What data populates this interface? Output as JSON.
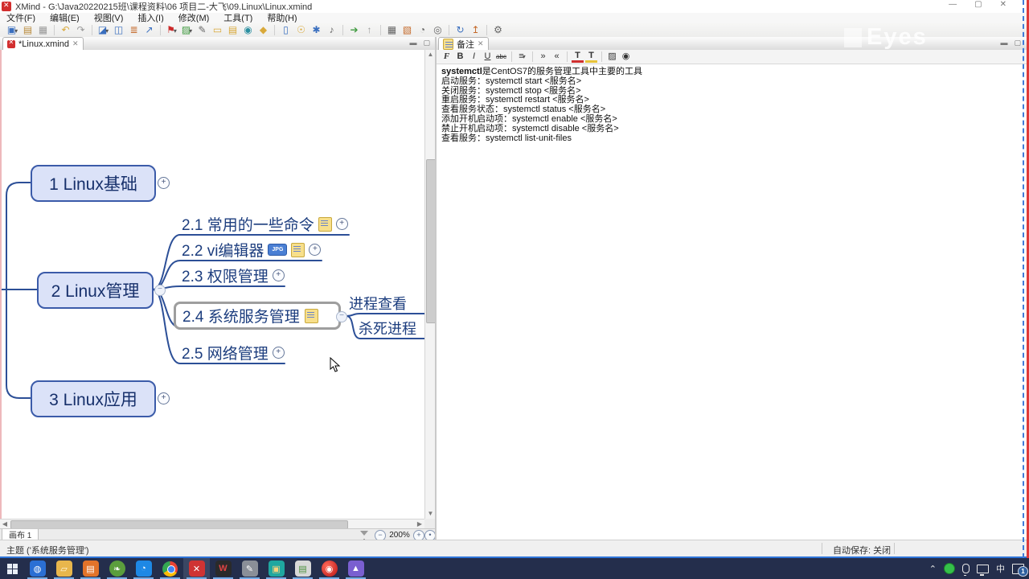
{
  "window": {
    "title": "XMind - G:\\Java20220215班\\课程资料\\06 项目二-大飞\\09.Linux\\Linux.xmind"
  },
  "menu": {
    "items": [
      "文件(F)",
      "编辑(E)",
      "视图(V)",
      "插入(I)",
      "修改(M)",
      "工具(T)",
      "帮助(H)"
    ]
  },
  "toolbar": {
    "icons": [
      {
        "name": "new-workbook",
        "glyph": "▣"
      },
      {
        "name": "open-file",
        "glyph": "▤"
      },
      {
        "name": "save",
        "glyph": "▦"
      },
      {
        "name": "undo",
        "glyph": "↶"
      },
      {
        "name": "redo",
        "glyph": "↷"
      },
      {
        "name": "theme",
        "glyph": "◪"
      },
      {
        "name": "map-structure",
        "glyph": "◫"
      },
      {
        "name": "outline-numbering",
        "glyph": "≣"
      },
      {
        "name": "relationship",
        "glyph": "↗"
      },
      {
        "name": "marker",
        "glyph": "⚑"
      },
      {
        "name": "insert-image",
        "glyph": "▨"
      },
      {
        "name": "attachment",
        "glyph": "✎"
      },
      {
        "name": "boundary",
        "glyph": "▭"
      },
      {
        "name": "insert-notes",
        "glyph": "▤"
      },
      {
        "name": "hyperlink",
        "glyph": "◉"
      },
      {
        "name": "label",
        "glyph": "◆"
      },
      {
        "name": "presentation",
        "glyph": "▯"
      },
      {
        "name": "brainstorm",
        "glyph": "☉"
      },
      {
        "name": "drill-down",
        "glyph": "✱"
      },
      {
        "name": "audio-note",
        "glyph": "♪"
      },
      {
        "name": "share",
        "glyph": "➔"
      },
      {
        "name": "upload",
        "glyph": "↑"
      },
      {
        "name": "table-view",
        "glyph": "▦"
      },
      {
        "name": "gantt-view",
        "glyph": "▧"
      },
      {
        "name": "timer",
        "glyph": "◔"
      },
      {
        "name": "zoom-tool",
        "glyph": "◎"
      },
      {
        "name": "cloud-sync",
        "glyph": "↻"
      },
      {
        "name": "export",
        "glyph": "↥"
      },
      {
        "name": "preferences",
        "glyph": "⚙"
      }
    ]
  },
  "editor": {
    "tab_label": "*Linux.xmind"
  },
  "mindmap": {
    "zoom_level": "200%",
    "colors": {
      "node_fill": "#dbe2f8",
      "node_border": "#3b5ba9",
      "branch": "#2c4f97",
      "text": "#1c3d7e",
      "selection": "#9e9e9e"
    },
    "level1": [
      {
        "label": "1 Linux基础"
      },
      {
        "label": "2 Linux管理"
      },
      {
        "label": "3 Linux应用"
      }
    ],
    "level2": [
      {
        "label": "2.1 常用的一些命令"
      },
      {
        "label": "2.2 vi编辑器"
      },
      {
        "label": "2.3 权限管理"
      },
      {
        "label": "2.4 系统服务管理"
      },
      {
        "label": "2.5 网络管理"
      }
    ],
    "level3": [
      {
        "label": "进程查看"
      },
      {
        "label": "杀死进程"
      }
    ],
    "jpg_badge": "JPG"
  },
  "canvas_bar": {
    "sheet": "画布 1",
    "zoom_level": "200%"
  },
  "notes": {
    "tab": "备注",
    "toolbar": [
      {
        "name": "font",
        "glyph": "F"
      },
      {
        "name": "bold",
        "glyph": "B"
      },
      {
        "name": "italic",
        "glyph": "I"
      },
      {
        "name": "underline",
        "glyph": "U"
      },
      {
        "name": "strikethrough",
        "glyph": "abc"
      },
      {
        "name": "bullet-list",
        "glyph": "≡"
      },
      {
        "name": "indent",
        "glyph": "»"
      },
      {
        "name": "outdent",
        "glyph": "«"
      },
      {
        "name": "text-color",
        "glyph": "T"
      },
      {
        "name": "highlight-color",
        "glyph": "T"
      },
      {
        "name": "insert-image",
        "glyph": "▨"
      },
      {
        "name": "insert-hyperlink",
        "glyph": "◉"
      }
    ],
    "line1_bold": "systemctl",
    "line1_rest": "是CentOS7的服务管理工具中主要的工具",
    "lines": [
      "启动服务：systemctl start <服务名>",
      "关闭服务：systemctl stop <服务名>",
      "重启服务：systemctl restart <服务名>",
      "查看服务状态：systemctl status <服务名>",
      "添加开机启动项：systemctl enable <服务名>",
      "禁止开机启动项：systemctl disable <服务名>",
      "查看服务：systemctl list-unit-files"
    ]
  },
  "watermark": {
    "text": "Eyes"
  },
  "status": {
    "left": "主题 ('系统服务管理')",
    "autosave": "自动保存: 关闭"
  },
  "taskbar": {
    "ime": "中",
    "notification_badge": "1",
    "wps_letter": "W"
  }
}
